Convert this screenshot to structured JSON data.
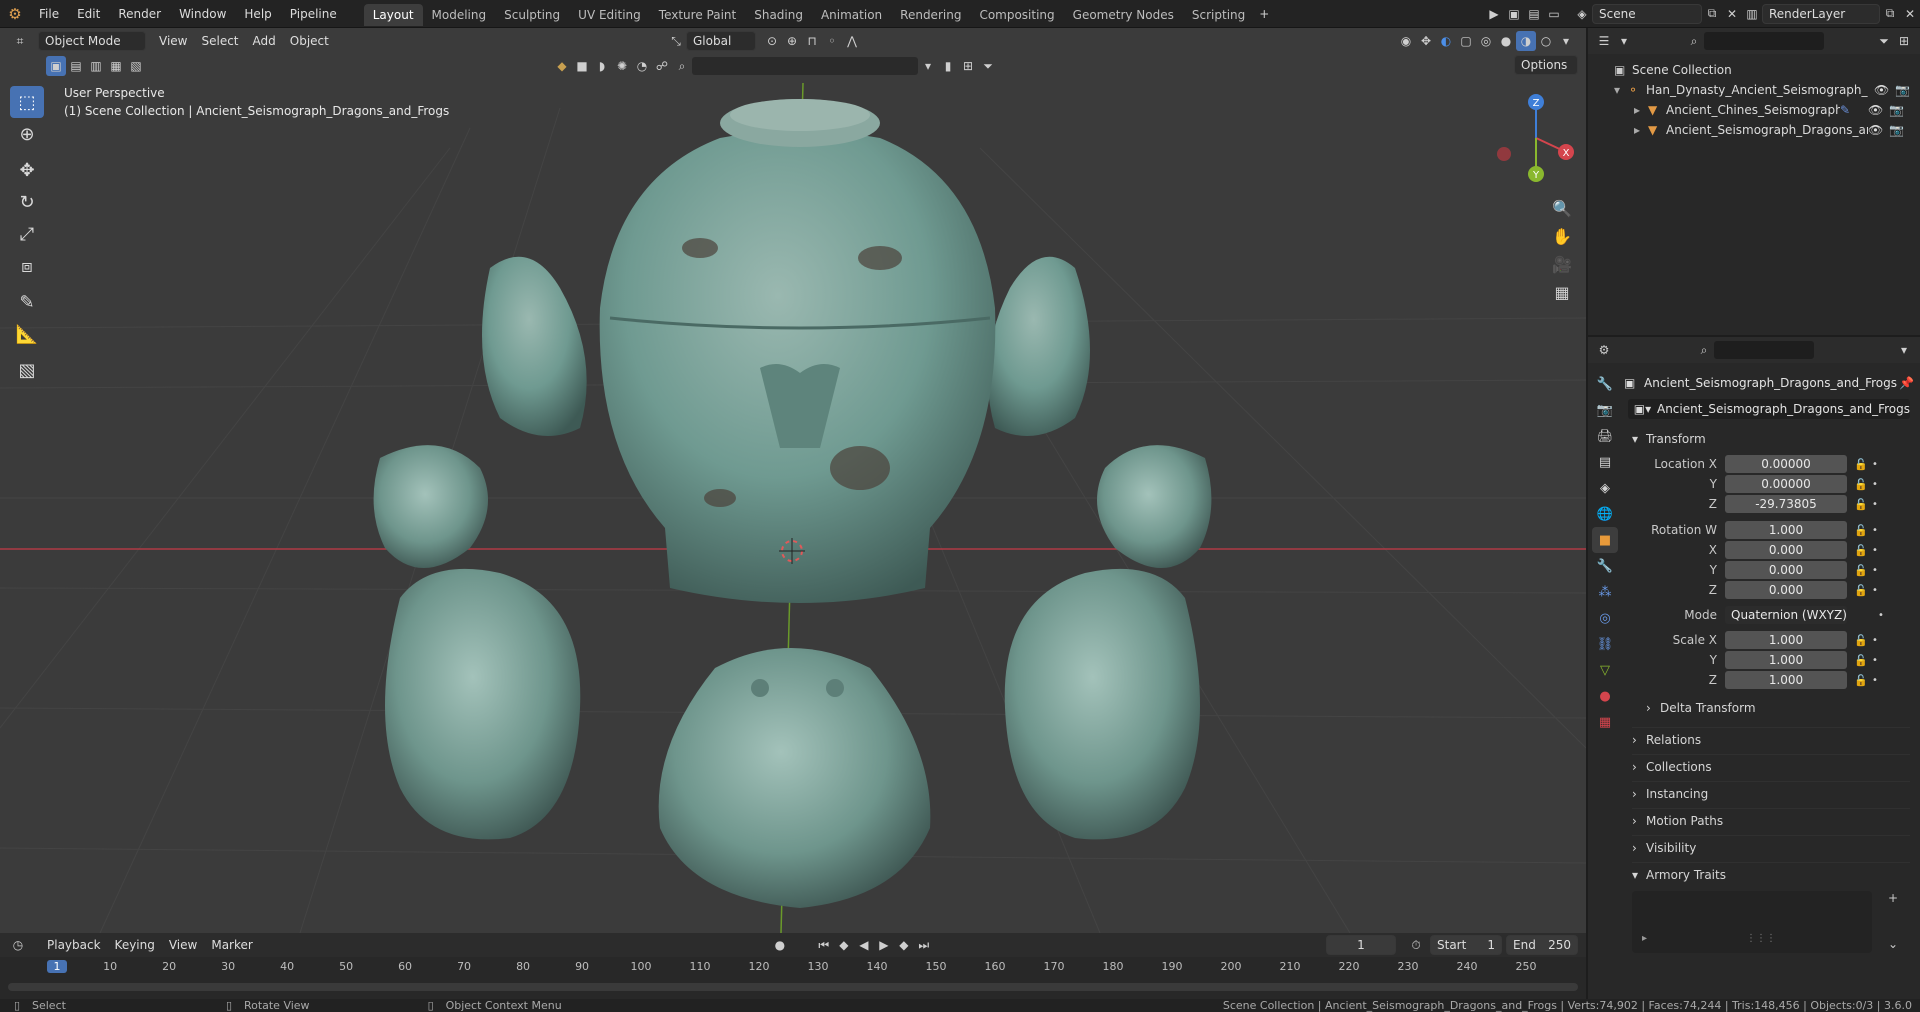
{
  "topbar": {
    "menus": [
      "File",
      "Edit",
      "Render",
      "Window",
      "Help",
      "Pipeline"
    ],
    "workspaces": [
      "Layout",
      "Modeling",
      "Sculpting",
      "UV Editing",
      "Texture Paint",
      "Shading",
      "Animation",
      "Rendering",
      "Compositing",
      "Geometry Nodes",
      "Scripting"
    ],
    "active_workspace": "Layout",
    "scene_name": "Scene",
    "view_layer": "RenderLayer"
  },
  "viewport": {
    "mode": "Object Mode",
    "menus": [
      "View",
      "Select",
      "Add",
      "Object"
    ],
    "orientation": "Global",
    "options_label": "Options",
    "perspective_label": "User Perspective",
    "collection_label": "(1) Scene Collection | Ancient_Seismograph_Dragons_and_Frogs",
    "gizmo_axes": [
      "Z",
      "X",
      "Y"
    ]
  },
  "outliner": {
    "root": "Scene Collection",
    "items": [
      {
        "label": "Han_Dynasty_Ancient_Seismograph_wil",
        "depth": 1
      },
      {
        "label": "Ancient_Chines_Seismograph",
        "depth": 2
      },
      {
        "label": "Ancient_Seismograph_Dragons_and",
        "depth": 2
      }
    ]
  },
  "properties": {
    "object_name": "Ancient_Seismograph_Dragons_and_Frogs",
    "datablock_name": "Ancient_Seismograph_Dragons_and_Frogs",
    "transform_header": "Transform",
    "location_label": "Location X",
    "location": [
      "0.00000",
      "0.00000",
      "-29.73805"
    ],
    "rotation_label": "Rotation W",
    "rotation": [
      "1.000",
      "0.000",
      "0.000",
      "0.000"
    ],
    "mode_label": "Mode",
    "mode_value": "Quaternion (WXYZ)",
    "scale_label": "Scale X",
    "scale": [
      "1.000",
      "1.000",
      "1.000"
    ],
    "axis_labels": [
      "X",
      "Y",
      "Z"
    ],
    "delta_transform": "Delta Transform",
    "panels": [
      "Relations",
      "Collections",
      "Instancing",
      "Motion Paths",
      "Visibility",
      "Armory Traits"
    ]
  },
  "timeline": {
    "menus": [
      "Playback",
      "Keying",
      "View",
      "Marker"
    ],
    "current_frame": "1",
    "start_label": "Start",
    "start": "1",
    "end_label": "End",
    "end": "250",
    "ticks": [
      "1",
      "10",
      "20",
      "30",
      "40",
      "50",
      "60",
      "70",
      "80",
      "90",
      "100",
      "110",
      "120",
      "130",
      "140",
      "150",
      "160",
      "170",
      "180",
      "190",
      "200",
      "210",
      "220",
      "230",
      "240",
      "250"
    ]
  },
  "status": {
    "select": "Select",
    "rotate": "Rotate View",
    "context": "Object Context Menu",
    "stats": "Scene Collection | Ancient_Seismograph_Dragons_and_Frogs | Verts:74,902 | Faces:74,244 | Tris:148,456 | Objects:0/3 | 3.6.0"
  },
  "colors": {
    "accent": "#4772b3",
    "bronze": "#6f9a91",
    "x_axis": "#d4454d",
    "y_axis": "#8ab82e",
    "z_axis": "#3f7fd8"
  }
}
